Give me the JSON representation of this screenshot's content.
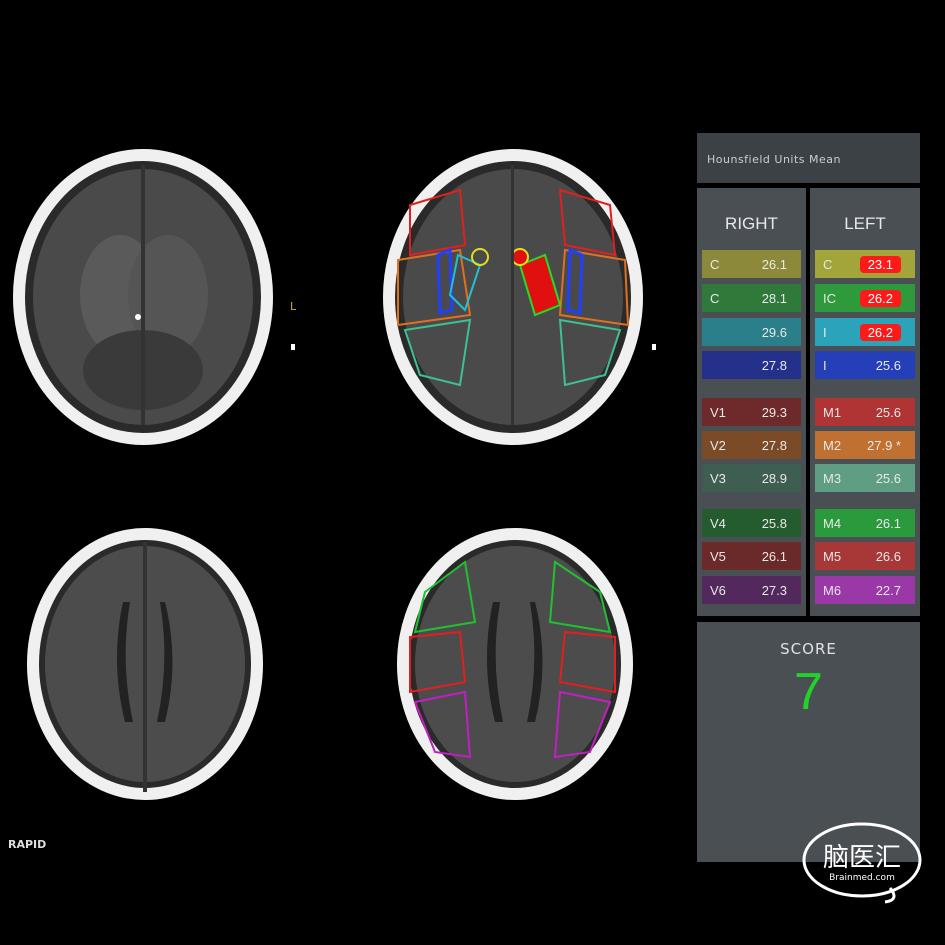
{
  "header": {
    "title": "Hounsfield Units Mean"
  },
  "columns": {
    "right": {
      "title": "RIGHT",
      "rows": [
        {
          "label": "C",
          "value": "26.1",
          "color": "#8c8a3a"
        },
        {
          "label": "C",
          "value": "28.1",
          "color": "#2f7a3a"
        },
        {
          "label": "",
          "value": "29.6",
          "color": "#2b7f8a"
        },
        {
          "label": "",
          "value": "27.8",
          "color": "#23318a"
        },
        {
          "label": "V1",
          "value": "29.3",
          "color": "#6e2a2a"
        },
        {
          "label": "V2",
          "value": "27.8",
          "color": "#7a4b26"
        },
        {
          "label": "V3",
          "value": "28.9",
          "color": "#3f5e52"
        },
        {
          "label": "V4",
          "value": "25.8",
          "color": "#245c30"
        },
        {
          "label": "V5",
          "value": "26.1",
          "color": "#6a2a2a"
        },
        {
          "label": "V6",
          "value": "27.3",
          "color": "#53285c"
        }
      ]
    },
    "left": {
      "title": "LEFT",
      "rows": [
        {
          "label": "C",
          "value": "23.1",
          "color": "#a3a43a",
          "flag": true
        },
        {
          "label": "IC",
          "value": "26.2",
          "color": "#2f9a3c",
          "flag": true
        },
        {
          "label": "I",
          "value": "26.2",
          "color": "#2ba3b8",
          "flag": true
        },
        {
          "label": "I",
          "value": "25.6",
          "color": "#243fb8"
        },
        {
          "label": "M1",
          "value": "25.6",
          "color": "#b03434"
        },
        {
          "label": "M2",
          "value": "27.9 *",
          "color": "#c07030"
        },
        {
          "label": "M3",
          "value": "25.6",
          "color": "#5f9e82"
        },
        {
          "label": "M4",
          "value": "26.1",
          "color": "#2a9a3c"
        },
        {
          "label": "M5",
          "value": "26.6",
          "color": "#a83838"
        },
        {
          "label": "M6",
          "value": "22.7",
          "color": "#9a38a8"
        }
      ]
    }
  },
  "score": {
    "label": "SCORE",
    "value": "7"
  },
  "footer": {
    "brand": "RAPID"
  },
  "logo": {
    "text": "脑医汇",
    "sub": "Brainmed.com"
  },
  "side_markers": {
    "l": "L"
  }
}
